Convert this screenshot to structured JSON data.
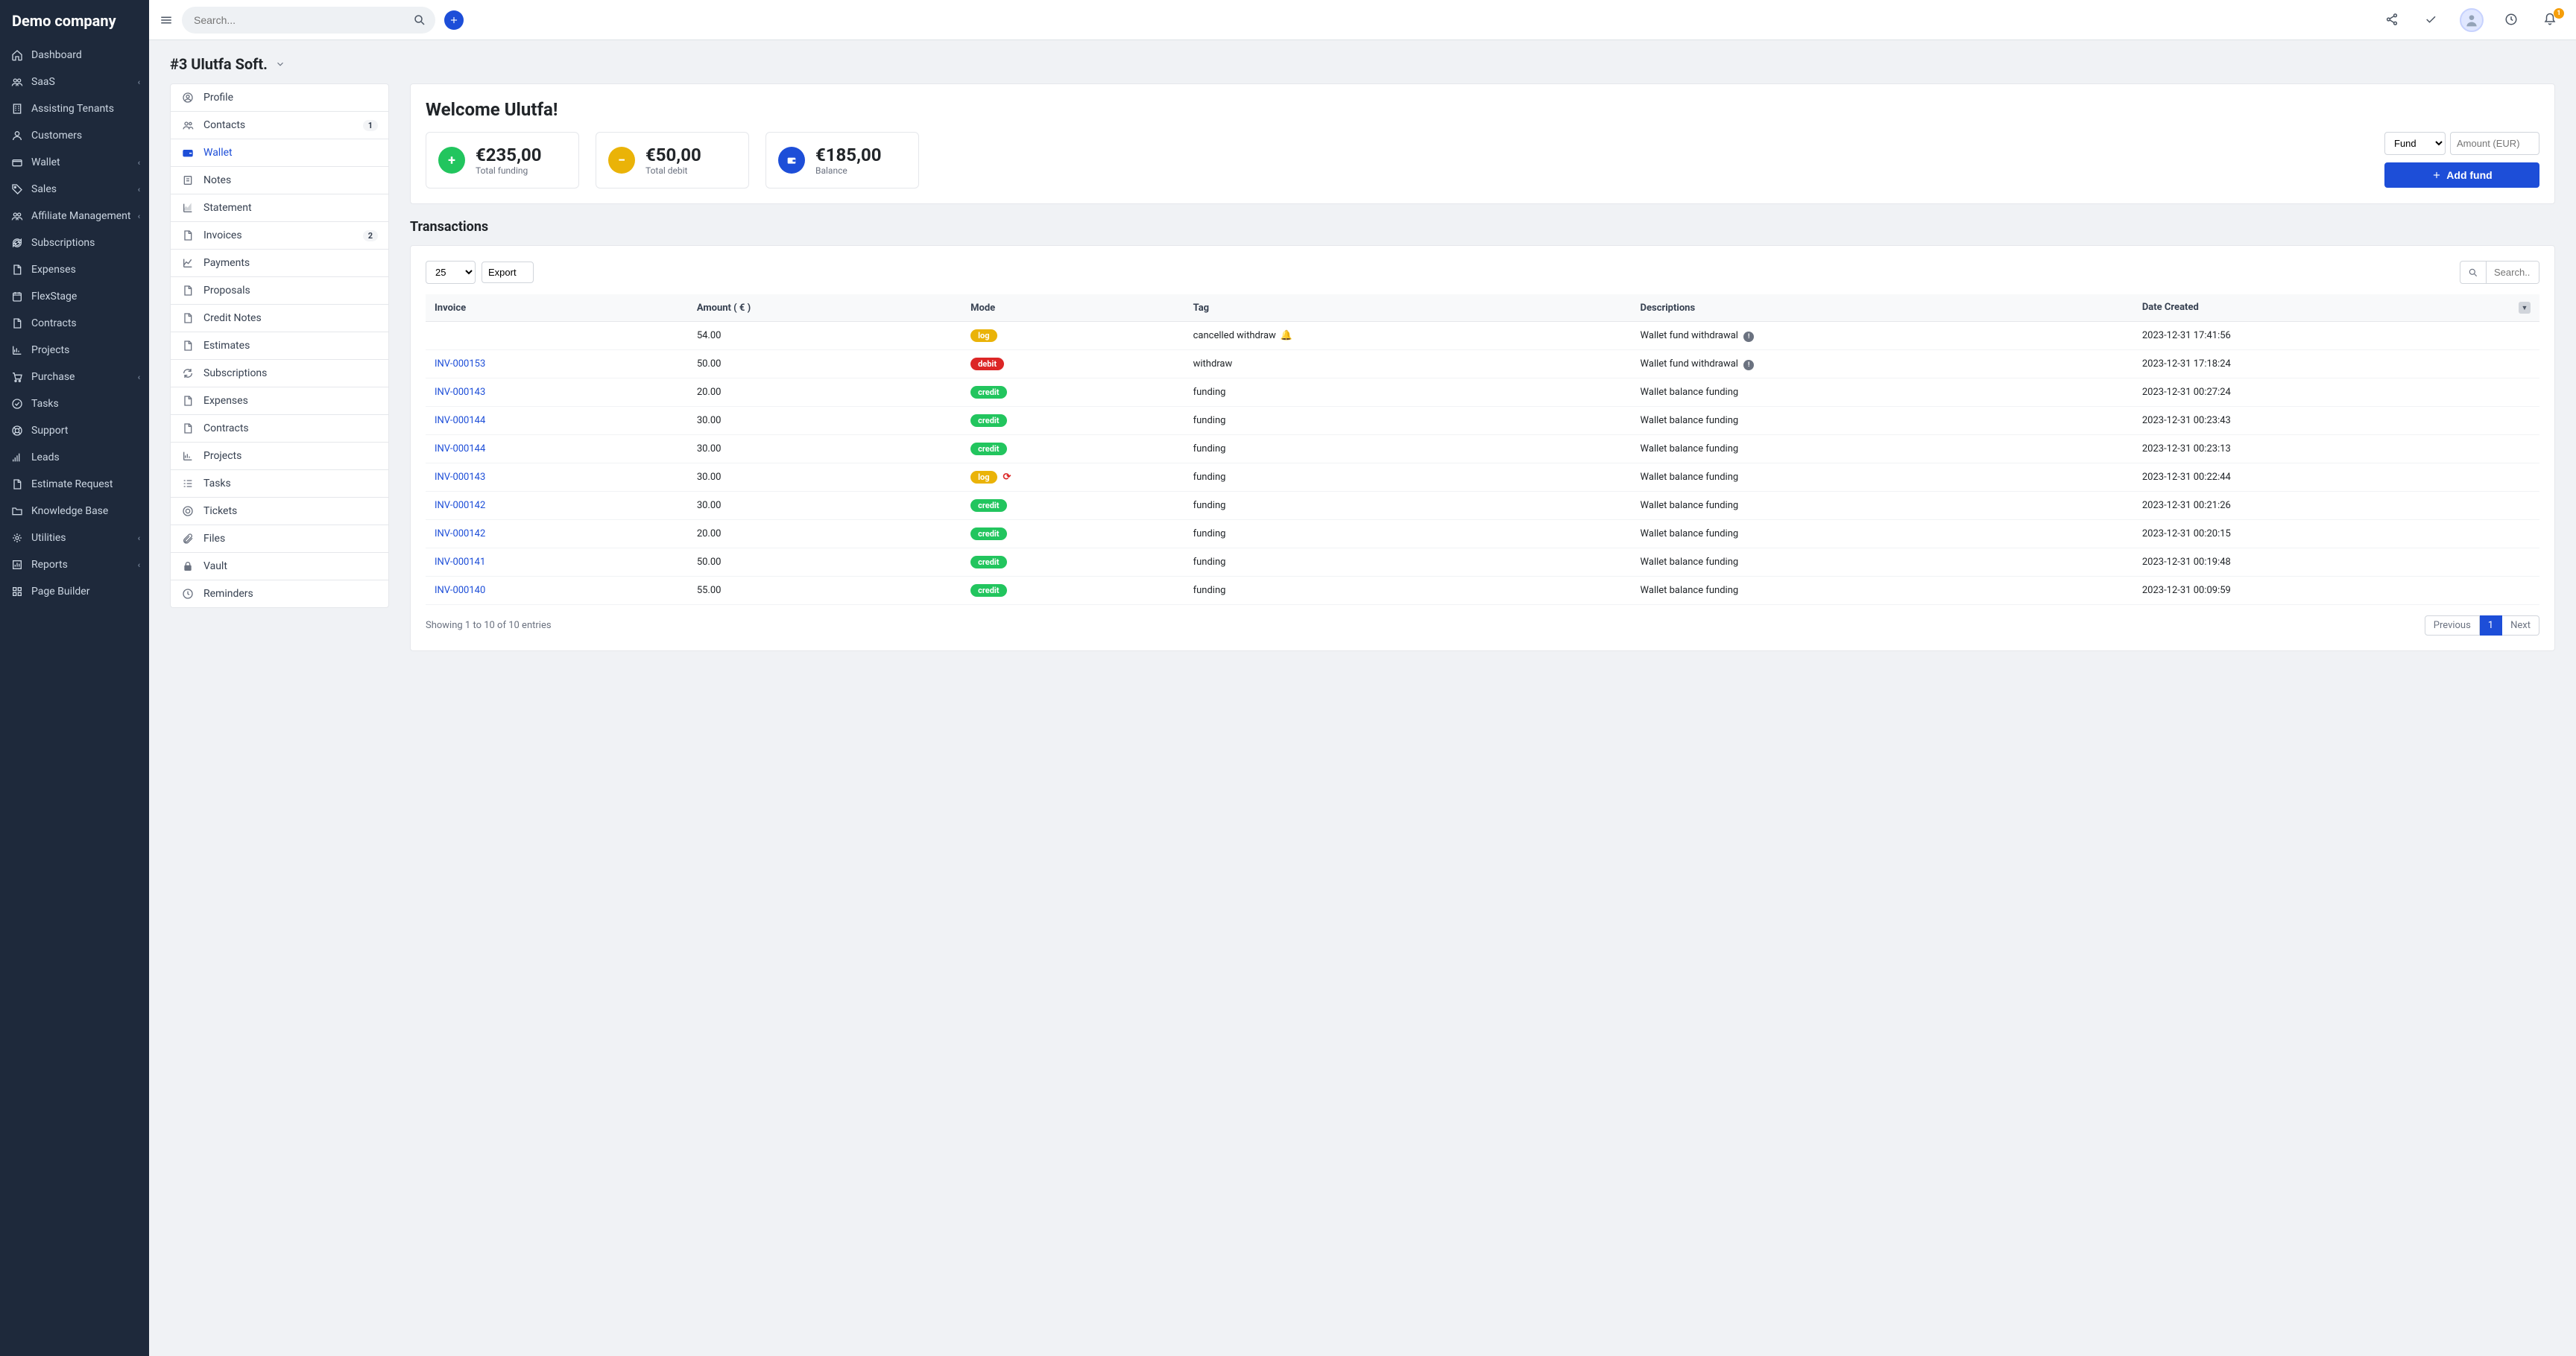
{
  "brand": "Demo company",
  "search": {
    "placeholder": "Search..."
  },
  "sidebar": {
    "items": [
      {
        "label": "Dashboard",
        "icon": "home",
        "expandable": false
      },
      {
        "label": "SaaS",
        "icon": "users-2",
        "expandable": true
      },
      {
        "label": "Assisting Tenants",
        "icon": "building",
        "expandable": false
      },
      {
        "label": "Customers",
        "icon": "user",
        "expandable": false
      },
      {
        "label": "Wallet",
        "icon": "wallet",
        "expandable": true
      },
      {
        "label": "Sales",
        "icon": "tag",
        "expandable": true
      },
      {
        "label": "Affiliate Management",
        "icon": "users-2",
        "expandable": true
      },
      {
        "label": "Subscriptions",
        "icon": "refresh",
        "expandable": false
      },
      {
        "label": "Expenses",
        "icon": "file",
        "expandable": false
      },
      {
        "label": "FlexStage",
        "icon": "calendar",
        "expandable": false
      },
      {
        "label": "Contracts",
        "icon": "file",
        "expandable": false
      },
      {
        "label": "Projects",
        "icon": "chart",
        "expandable": false
      },
      {
        "label": "Purchase",
        "icon": "cart",
        "expandable": true
      },
      {
        "label": "Tasks",
        "icon": "check-circle",
        "expandable": false
      },
      {
        "label": "Support",
        "icon": "life-ring",
        "expandable": false
      },
      {
        "label": "Leads",
        "icon": "signal",
        "expandable": false
      },
      {
        "label": "Estimate Request",
        "icon": "file",
        "expandable": false
      },
      {
        "label": "Knowledge Base",
        "icon": "folder",
        "expandable": false
      },
      {
        "label": "Utilities",
        "icon": "gears",
        "expandable": true
      },
      {
        "label": "Reports",
        "icon": "report",
        "expandable": true
      },
      {
        "label": "Page Builder",
        "icon": "grid",
        "expandable": false
      }
    ]
  },
  "page": {
    "title": "#3 Ulutfa Soft."
  },
  "nav_tabs": [
    {
      "label": "Profile",
      "icon": "user-circle"
    },
    {
      "label": "Contacts",
      "icon": "users",
      "badge": "1"
    },
    {
      "label": "Wallet",
      "icon": "wallet-s",
      "active": true
    },
    {
      "label": "Notes",
      "icon": "note"
    },
    {
      "label": "Statement",
      "icon": "area-chart"
    },
    {
      "label": "Invoices",
      "icon": "file-s",
      "badge": "2"
    },
    {
      "label": "Payments",
      "icon": "line-chart"
    },
    {
      "label": "Proposals",
      "icon": "file-s"
    },
    {
      "label": "Credit Notes",
      "icon": "file-s"
    },
    {
      "label": "Estimates",
      "icon": "file-s"
    },
    {
      "label": "Subscriptions",
      "icon": "refresh-s"
    },
    {
      "label": "Expenses",
      "icon": "file-s"
    },
    {
      "label": "Contracts",
      "icon": "file-s"
    },
    {
      "label": "Projects",
      "icon": "chart-s"
    },
    {
      "label": "Tasks",
      "icon": "tasks"
    },
    {
      "label": "Tickets",
      "icon": "life-ring-s"
    },
    {
      "label": "Files",
      "icon": "paperclip"
    },
    {
      "label": "Vault",
      "icon": "lock"
    },
    {
      "label": "Reminders",
      "icon": "clock"
    }
  ],
  "welcome": {
    "title": "Welcome Ulutfa!"
  },
  "stats": {
    "total_funding": {
      "value": "€235,00",
      "label": "Total funding"
    },
    "total_debit": {
      "value": "€50,00",
      "label": "Total debit"
    },
    "balance": {
      "value": "€185,00",
      "label": "Balance"
    }
  },
  "fund_form": {
    "select_label": "Fund",
    "amount_placeholder": "Amount (EUR)",
    "button_label": "Add fund"
  },
  "transactions": {
    "title": "Transactions",
    "page_size": "25",
    "export_label": "Export",
    "search_placeholder": "Search..",
    "columns": {
      "invoice": "Invoice",
      "amount": "Amount ( € )",
      "mode": "Mode",
      "tag": "Tag",
      "descriptions": "Descriptions",
      "date_created": "Date Created"
    },
    "rows": [
      {
        "invoice": "",
        "amount": "54.00",
        "mode": "log",
        "tag": "cancelled withdraw",
        "tag_bell": true,
        "description": "Wallet fund withdrawal",
        "desc_info": true,
        "date": "2023-12-31 17:41:56"
      },
      {
        "invoice": "INV-000153",
        "amount": "50.00",
        "mode": "debit",
        "tag": "withdraw",
        "description": "Wallet fund withdrawal",
        "desc_info": true,
        "date": "2023-12-31 17:18:24"
      },
      {
        "invoice": "INV-000143",
        "amount": "20.00",
        "mode": "credit",
        "tag": "funding",
        "description": "Wallet balance funding",
        "date": "2023-12-31 00:27:24"
      },
      {
        "invoice": "INV-000144",
        "amount": "30.00",
        "mode": "credit",
        "tag": "funding",
        "description": "Wallet balance funding",
        "date": "2023-12-31 00:23:43"
      },
      {
        "invoice": "INV-000144",
        "amount": "30.00",
        "mode": "credit",
        "tag": "funding",
        "description": "Wallet balance funding",
        "date": "2023-12-31 00:23:13"
      },
      {
        "invoice": "INV-000143",
        "amount": "30.00",
        "mode": "log",
        "mode_refresh": true,
        "tag": "funding",
        "description": "Wallet balance funding",
        "date": "2023-12-31 00:22:44"
      },
      {
        "invoice": "INV-000142",
        "amount": "30.00",
        "mode": "credit",
        "tag": "funding",
        "description": "Wallet balance funding",
        "date": "2023-12-31 00:21:26"
      },
      {
        "invoice": "INV-000142",
        "amount": "20.00",
        "mode": "credit",
        "tag": "funding",
        "description": "Wallet balance funding",
        "date": "2023-12-31 00:20:15"
      },
      {
        "invoice": "INV-000141",
        "amount": "50.00",
        "mode": "credit",
        "tag": "funding",
        "description": "Wallet balance funding",
        "date": "2023-12-31 00:19:48"
      },
      {
        "invoice": "INV-000140",
        "amount": "55.00",
        "mode": "credit",
        "tag": "funding",
        "description": "Wallet balance funding",
        "date": "2023-12-31 00:09:59"
      }
    ],
    "footer_text": "Showing 1 to 10 of 10 entries",
    "pagination": {
      "prev": "Previous",
      "current": "1",
      "next": "Next"
    }
  },
  "topbar": {
    "notification_count": "1"
  }
}
